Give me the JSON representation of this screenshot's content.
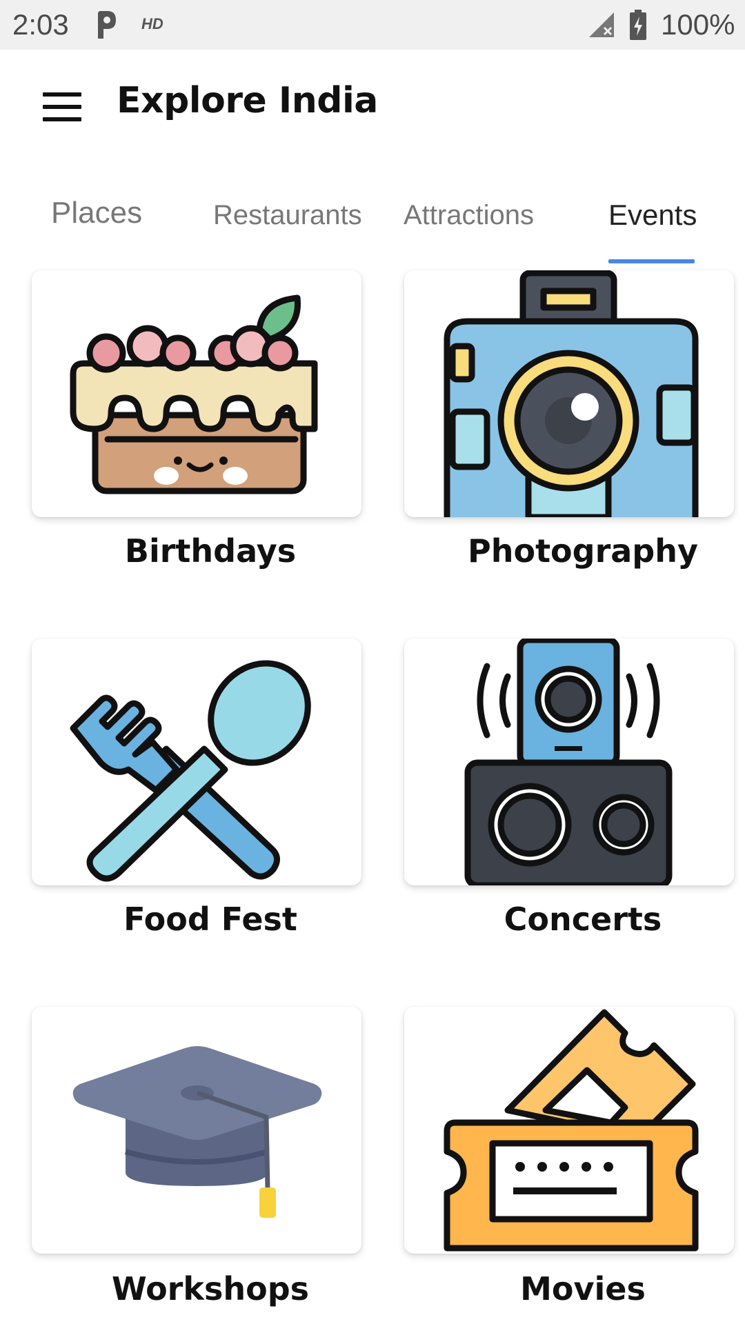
{
  "status_bar": {
    "time": "2:03",
    "hd": "HD",
    "battery": "100%"
  },
  "app_bar": {
    "title": "Explore India"
  },
  "tabs": [
    {
      "label": "Places",
      "active": false
    },
    {
      "label": "Restaurants",
      "active": false
    },
    {
      "label": "Attractions",
      "active": false
    },
    {
      "label": "Events",
      "active": true
    }
  ],
  "events": [
    {
      "label": "Birthdays",
      "icon": "birthday-cake-icon"
    },
    {
      "label": "Photography",
      "icon": "camera-icon"
    },
    {
      "label": "Food Fest",
      "icon": "fork-spoon-icon"
    },
    {
      "label": "Concerts",
      "icon": "speakers-icon"
    },
    {
      "label": "Workshops",
      "icon": "graduation-cap-icon"
    },
    {
      "label": "Movies",
      "icon": "movie-tickets-icon"
    }
  ],
  "colors": {
    "tab_indicator": "#4a86e8",
    "status_bar_bg": "#f0f0f0"
  }
}
